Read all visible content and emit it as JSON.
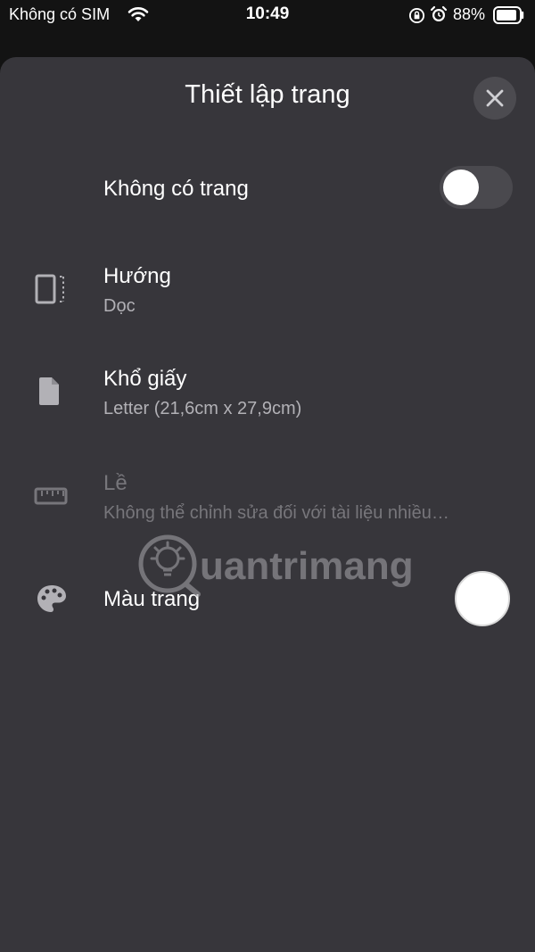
{
  "status": {
    "carrier": "Không có SIM",
    "time": "10:49",
    "battery": "88%"
  },
  "sheet": {
    "title": "Thiết lập trang",
    "close_icon": "close-icon",
    "rows": {
      "no_pages": {
        "title": "Không có trang",
        "toggle_on": false
      },
      "orientation": {
        "title": "Hướng",
        "value": "Dọc",
        "icon": "orientation-icon"
      },
      "paper_size": {
        "title": "Khổ giấy",
        "value": "Letter (21,6cm x 27,9cm)",
        "icon": "document-icon"
      },
      "margins": {
        "title": "Lề",
        "value": "Không thể chỉnh sửa đối với tài liệu nhiều…",
        "icon": "ruler-icon",
        "disabled": true
      },
      "page_color": {
        "title": "Màu trang",
        "icon": "palette-icon",
        "color": "#ffffff"
      }
    }
  },
  "watermark": "uantrimang",
  "colors": {
    "background": "#131313",
    "sheet": "#37363b",
    "secondary_text": "#b2b1b6",
    "disabled_text": "#77767b"
  }
}
